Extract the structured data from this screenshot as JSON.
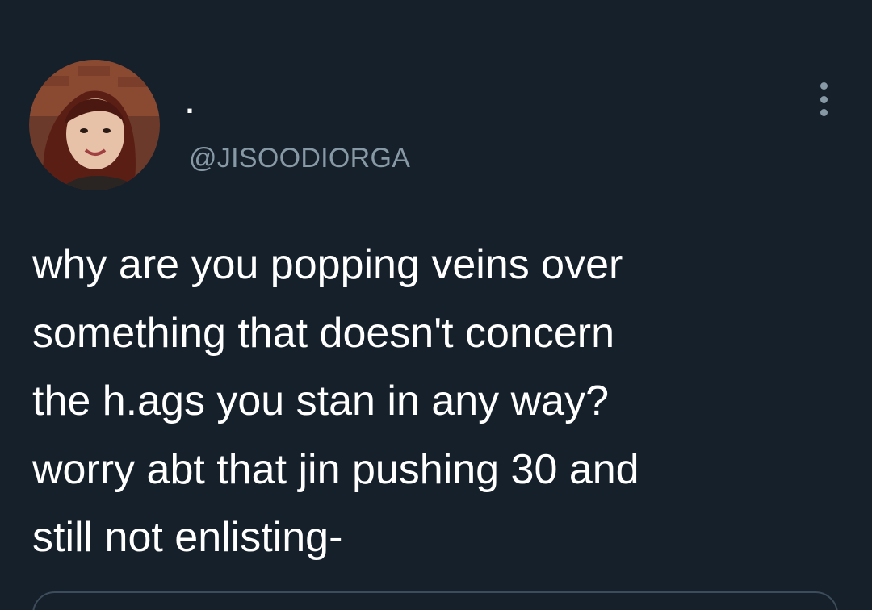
{
  "tweet": {
    "display_name": ".",
    "handle": "@JISOODIORGA",
    "text_lines": [
      "why are you popping veins over",
      "something that doesn't concern",
      "the h.ags you stan in any way?",
      "worry abt that jin pushing 30 and",
      "still not enlisting-"
    ],
    "avatar_icon": "avatar-photo",
    "more_icon": "more-vertical-icon"
  },
  "colors": {
    "background": "#15202b",
    "text": "#ffffff",
    "secondary_text": "#8899a6",
    "border": "#3d4c5a"
  }
}
